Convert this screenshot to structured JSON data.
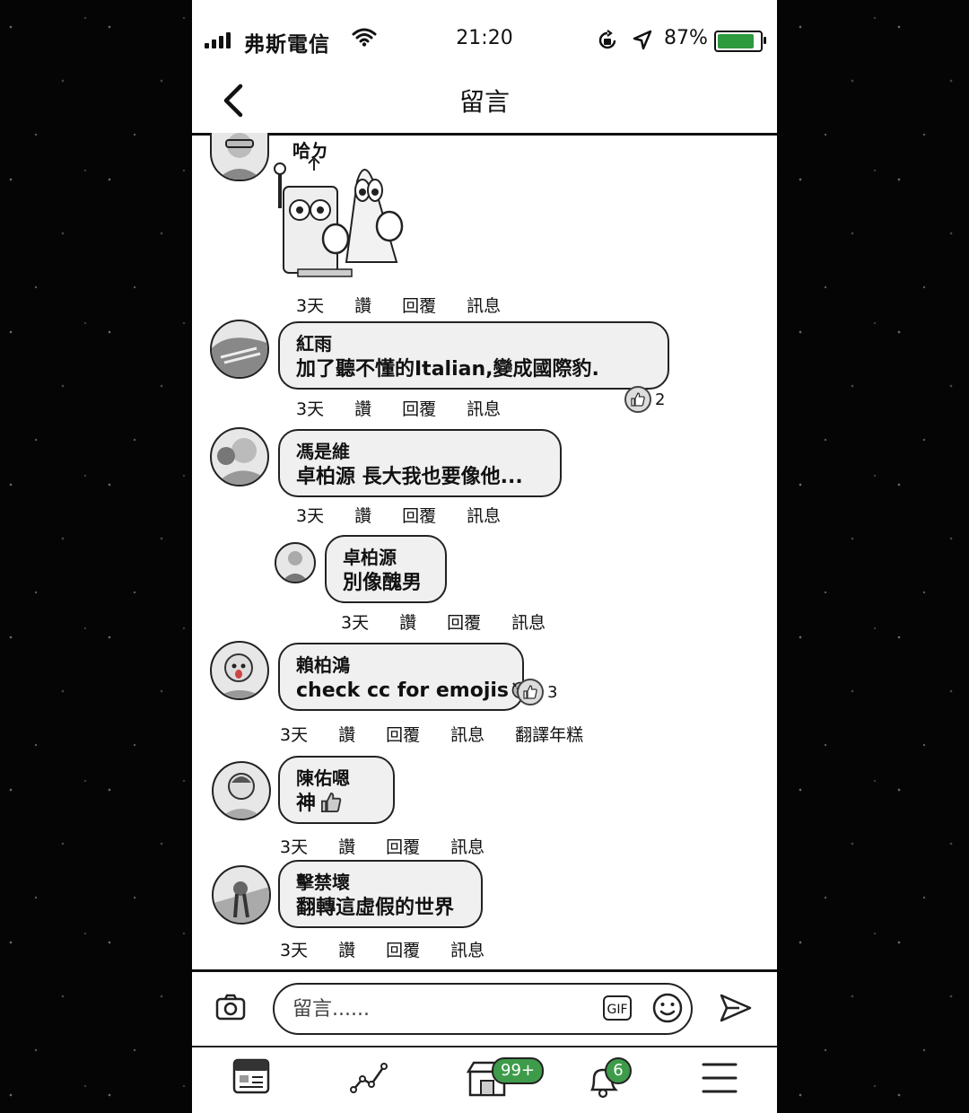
{
  "status_bar": {
    "carrier": "弗斯電信",
    "time": "21:20",
    "battery_percent": "87%",
    "battery_level": 0.87,
    "battery_color": "#2e9a3e"
  },
  "nav": {
    "title": "留言"
  },
  "actions": {
    "time": "3天",
    "like": "讚",
    "reply": "回覆",
    "message": "訊息"
  },
  "comments": [
    {
      "name": "哈ㄉ",
      "text": "",
      "sticker": true
    },
    {
      "name": "紅雨",
      "text": "加了聽不懂的Italian,變成國際豹.",
      "reactions": "2"
    },
    {
      "name": "馮是維",
      "text": "卓柏源  長大我也要像他..."
    },
    {
      "name": "卓柏源",
      "text": "別像醜男",
      "is_reply": true
    },
    {
      "name": "賴柏鴻",
      "text": "check cc for emojis",
      "reactions": "3",
      "extra_action": "翻譯年糕"
    },
    {
      "name": "陳佑嗯",
      "text": "神"
    },
    {
      "name": "擊禁壞",
      "text": "翻轉這虛假的世界"
    }
  ],
  "composer": {
    "placeholder": "留言......",
    "gif_label": "GIF"
  },
  "tabbar": {
    "feed_badge": "99+",
    "notifications_badge": "6",
    "badge_color": "#3e9b4a"
  }
}
